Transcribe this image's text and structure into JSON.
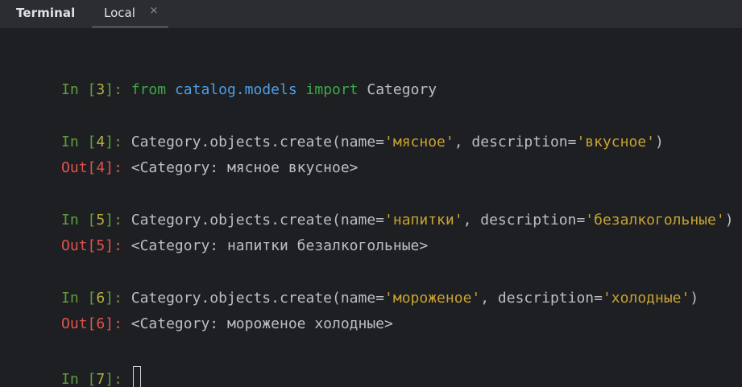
{
  "tool_window": {
    "title": "Terminal",
    "tabs": [
      {
        "label": "Local",
        "close_glyph": "×",
        "active": true
      }
    ]
  },
  "console": {
    "lines": [
      {
        "kind": "in",
        "prompt_label": "In ",
        "prompt_open": "[",
        "number": "3",
        "prompt_close": "]: ",
        "tokens": {
          "kw1": "from",
          "sp1": " ",
          "module": "catalog.models",
          "sp2": " ",
          "kw2": "import",
          "rest": " Category"
        }
      },
      {
        "kind": "in",
        "prompt_label": "In ",
        "prompt_open": "[",
        "number": "4",
        "prompt_close": "]: ",
        "tokens": {
          "a": "Category.objects.create(name=",
          "s1": "'мясное'",
          "b": ", description=",
          "s2": "'вкусное'",
          "c": ")"
        }
      },
      {
        "kind": "out",
        "prompt_label": "Out",
        "prompt_open": "[",
        "number": "4",
        "prompt_close": "]: ",
        "text": "<Category: мясное вкусное>"
      },
      {
        "kind": "in",
        "prompt_label": "In ",
        "prompt_open": "[",
        "number": "5",
        "prompt_close": "]: ",
        "tokens": {
          "a": "Category.objects.create(name=",
          "s1": "'напитки'",
          "b": ", description=",
          "s2": "'безалкогольные'",
          "c": ")"
        }
      },
      {
        "kind": "out",
        "prompt_label": "Out",
        "prompt_open": "[",
        "number": "5",
        "prompt_close": "]: ",
        "text": "<Category: напитки безалкогольные>"
      },
      {
        "kind": "in",
        "prompt_label": "In ",
        "prompt_open": "[",
        "number": "6",
        "prompt_close": "]: ",
        "tokens": {
          "a": "Category.objects.create(name=",
          "s1": "'мороженое'",
          "b": ", description=",
          "s2": "'холодные'",
          "c": ")"
        }
      },
      {
        "kind": "out",
        "prompt_label": "Out",
        "prompt_open": "[",
        "number": "6",
        "prompt_close": "]: ",
        "text": "<Category: мороженое холодные>"
      },
      {
        "kind": "in",
        "prompt_label": "In ",
        "prompt_open": "[",
        "number": "7",
        "prompt_close": "]: ",
        "text": ""
      }
    ]
  },
  "colors": {
    "background": "#1e1f22",
    "tabbar": "#2b2d30",
    "prompt_in": "#5e9d3d",
    "prompt_number": "#b5b13b",
    "prompt_out": "#e0534d",
    "keyword": "#3ca846",
    "module": "#4b9ee8",
    "string": "#c8a331",
    "text": "#bcbec4"
  }
}
